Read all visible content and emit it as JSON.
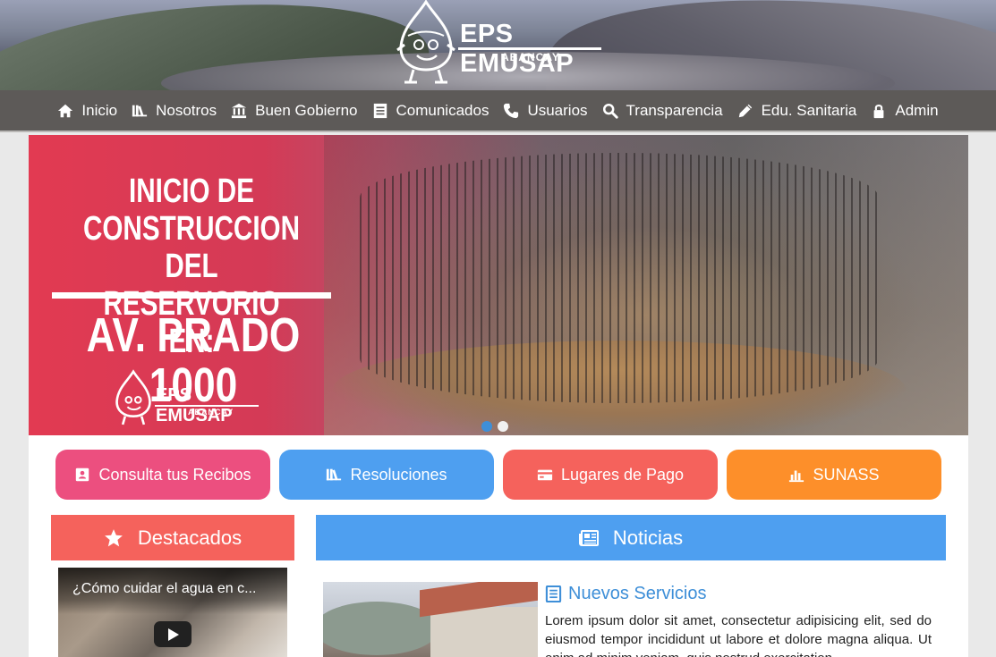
{
  "header": {
    "logo_text": "EPS EMUSAP",
    "logo_sub": "ABANCAY"
  },
  "nav": {
    "items": [
      {
        "label": "Inicio",
        "icon": "home-icon"
      },
      {
        "label": "Nosotros",
        "icon": "books-icon"
      },
      {
        "label": "Buen Gobierno",
        "icon": "bank-icon"
      },
      {
        "label": "Comunicados",
        "icon": "document-icon"
      },
      {
        "label": "Usuarios",
        "icon": "phone-icon"
      },
      {
        "label": "Transparencia",
        "icon": "search-icon"
      },
      {
        "label": "Edu. Sanitaria",
        "icon": "pencil-icon"
      },
      {
        "label": "Admin",
        "icon": "lock-icon"
      }
    ]
  },
  "banner": {
    "line1": "INICIO DE",
    "line2": "CONSTRUCCION DEL",
    "line3": "RESERVORIO EN:",
    "line4": "AV. PRADO 1000",
    "logo_text": "EPS EMUSAP",
    "logo_sub": "ABANCAY",
    "slides": 2,
    "active_slide": 1
  },
  "quick_buttons": [
    {
      "label": "Consulta tus Recibos",
      "icon": "id-card-icon",
      "color": "#ec4f7f"
    },
    {
      "label": "Resoluciones",
      "icon": "books-icon",
      "color": "#4e9ff0"
    },
    {
      "label": "Lugares de Pago",
      "icon": "credit-card-icon",
      "color": "#f5625c"
    },
    {
      "label": "SUNASS",
      "icon": "bar-chart-icon",
      "color": "#fd8f2a"
    }
  ],
  "destacados": {
    "title": "Destacados",
    "color": "#f5625c",
    "video_title": "¿Cómo cuidar el agua en c..."
  },
  "noticias": {
    "title": "Noticias",
    "color": "#4e9ff0",
    "item_title": "Nuevos Servicios",
    "item_body": "Lorem ipsum dolor sit amet, consectetur adipisicing elit, sed do eiusmod tempor incididunt ut labore et dolore magna aliqua. Ut enim ad minim veniam, quis nostrud exercitation"
  }
}
